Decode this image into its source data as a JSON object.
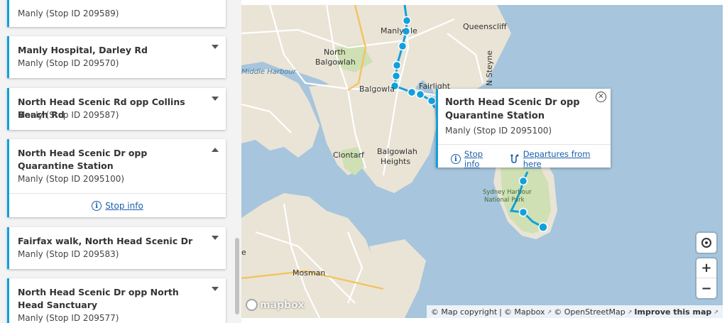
{
  "list": {
    "cards": [
      {
        "title": "",
        "subtitle": "Manly (Stop ID 209589)",
        "expanded": false
      },
      {
        "title": "Manly Hospital, Darley Rd",
        "subtitle": "Manly (Stop ID 209570)",
        "expanded": false
      },
      {
        "title": "North Head Scenic Rd opp Collins Beach Rd",
        "subtitle": "Manly (Stop ID 209587)",
        "expanded": false
      },
      {
        "title": "North Head Scenic Dr opp Quarantine Station",
        "subtitle": "Manly (Stop ID 2095100)",
        "expanded": true,
        "action": "Stop info"
      },
      {
        "title": "Fairfax walk, North Head Scenic Dr",
        "subtitle": "Manly (Stop ID 209583)",
        "expanded": false
      },
      {
        "title": "North Head Scenic Dr opp North Head Sanctuary",
        "subtitle": "Manly (Stop ID 209577)",
        "expanded": false
      }
    ]
  },
  "map": {
    "labels": {
      "manly": "Manly",
      "manly_suffix": "le",
      "queenscliff": "Queenscliff",
      "north_balgowlah": [
        "North",
        "Balgowlah"
      ],
      "middle_harbour": "Middle Harbour",
      "balgowlah": "Balgowla",
      "fairlight": "Fairlight",
      "n_steyne": "N Steyne",
      "clontarf": "Clontarf",
      "balgowlah_heights": [
        "Balgowlah",
        "Heights"
      ],
      "sydney_harbour_np": [
        "Sydney Harbour",
        "National Park"
      ],
      "mosman": "Mosman",
      "edge_e": "e"
    },
    "popup": {
      "title": "North Head Scenic Dr opp Quarantine Station",
      "subtitle": "Manly (Stop ID 2095100)",
      "close_symbol": "×",
      "stop_info": "Stop info",
      "departures": "Departures from here"
    },
    "controls": {
      "zoom_in": "+",
      "zoom_out": "−",
      "locate_icon": "locate-icon"
    },
    "logo": "mapbox",
    "attribution": {
      "copyright": "© Map copyright",
      "sep": "|",
      "mapbox": "© Mapbox",
      "osm": "© OpenStreetMap",
      "improve": "Improve this map"
    },
    "colors": {
      "route": "#12a0dc",
      "water": "#a7c5dc",
      "land": "#e9e4d6",
      "park": "#cfe0b4"
    }
  }
}
